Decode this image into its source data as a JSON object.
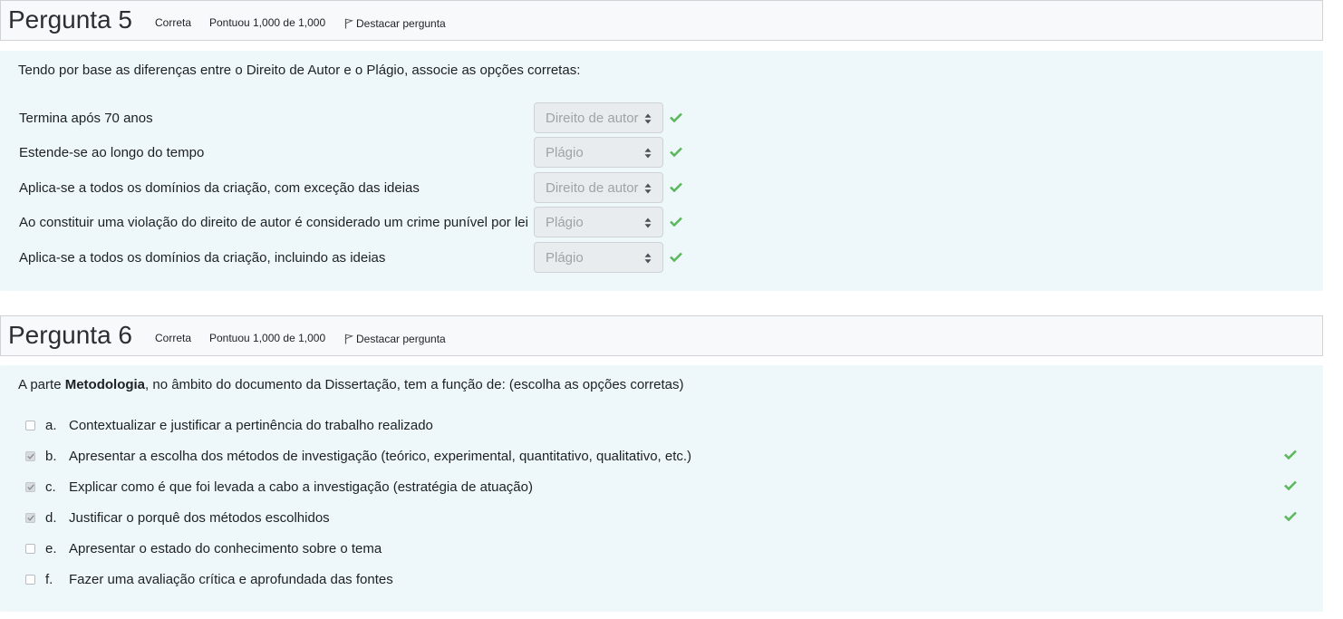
{
  "q5": {
    "title": "Pergunta 5",
    "status": "Correta",
    "score": "Pontuou 1,000 de 1,000",
    "flag_label": "Destacar pergunta",
    "stem": "Tendo por base as diferenças entre o Direito de Autor e o Plágio, associe as opções corretas:",
    "rows": [
      {
        "text": "Termina após 70 anos",
        "selected": "Direito de autor",
        "correct": true
      },
      {
        "text": "Estende-se ao longo do tempo",
        "selected": "Plágio",
        "correct": true
      },
      {
        "text": "Aplica-se a todos os domínios da criação, com exceção das ideias",
        "selected": "Direito de autor",
        "correct": true
      },
      {
        "text": "Ao constituir uma violação do direito de autor é considerado um crime punível por lei",
        "selected": "Plágio",
        "correct": true
      },
      {
        "text": "Aplica-se a todos os domínios da criação, incluindo as ideias",
        "selected": "Plágio",
        "correct": true
      }
    ]
  },
  "q6": {
    "title": "Pergunta 6",
    "status": "Correta",
    "score": "Pontuou 1,000 de 1,000",
    "flag_label": "Destacar pergunta",
    "stem_prefix": "A parte ",
    "stem_bold": "Metodologia",
    "stem_suffix": ", no âmbito do documento da Dissertação, tem a função de: (escolha as opções corretas)",
    "options": [
      {
        "letter": "a.",
        "text": "Contextualizar e justificar a pertinência do trabalho realizado",
        "checked": false,
        "correct": false
      },
      {
        "letter": "b.",
        "text": "Apresentar a escolha dos métodos de investigação (teórico, experimental, quantitativo, qualitativo, etc.)",
        "checked": true,
        "correct": true
      },
      {
        "letter": "c.",
        "text": "Explicar como é que foi levada a cabo a investigação (estratégia de atuação)",
        "checked": true,
        "correct": true
      },
      {
        "letter": "d.",
        "text": "Justificar o porquê dos métodos escolhidos",
        "checked": true,
        "correct": true
      },
      {
        "letter": "e.",
        "text": "Apresentar o estado do conhecimento sobre o tema",
        "checked": false,
        "correct": false
      },
      {
        "letter": "f.",
        "text": "Fazer uma avaliação crítica e aprofundada das fontes",
        "checked": false,
        "correct": false
      }
    ]
  },
  "colors": {
    "check_green": "#5cb85c",
    "panel_bg": "#eef7fa",
    "header_bg": "#f8f9fa"
  },
  "icons": {
    "flag": "flag-icon",
    "correct": "check-icon",
    "select_arrows": "sort-arrows-icon"
  }
}
